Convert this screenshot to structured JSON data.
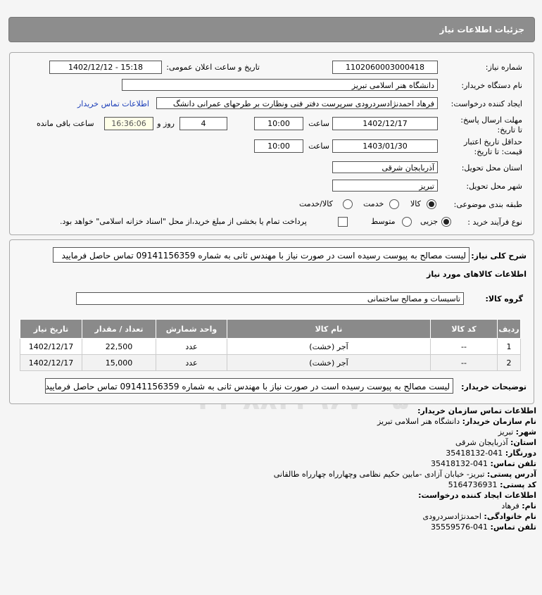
{
  "header": {
    "title": "جزئیات اطلاعات نیاز"
  },
  "form": {
    "need_number_label": "شماره نیاز:",
    "need_number": "1102060003000418",
    "announce_label": "تاریخ و ساعت اعلان عمومی:",
    "announce_value": "1402/12/12 - 15:18",
    "buyer_org_label": "نام دستگاه خریدار:",
    "buyer_org": "دانشگاه هنر اسلامی تبریز",
    "creator_label": "ایجاد کننده درخواست:",
    "creator": "فرهاد احمدنژادسردرودی سرپرست دفتر فنی ونظارت بر طرحهای عمرانی دانشگ",
    "contact_link": "اطلاعات تماس خریدار",
    "deadline_label": "مهلت ارسال پاسخ: تا تاریخ:",
    "deadline_date": "1402/12/17",
    "time_label": "ساعت",
    "deadline_time": "10:00",
    "days_value": "4",
    "days_label": "روز و",
    "remaining_time": "16:36:06",
    "remaining_label": "ساعت باقی مانده",
    "validity_label": "حداقل تاریخ اعتبار قیمت: تا تاریخ:",
    "validity_date": "1403/01/30",
    "validity_time_label": "ساعت",
    "validity_time": "10:00",
    "province_label": "استان محل تحویل:",
    "province": "آذربایجان شرقی",
    "city_label": "شهر محل تحویل:",
    "city": "تبریز",
    "category_label": "طبقه بندی موضوعی:",
    "category_options": [
      "کالا",
      "خدمت",
      "کالا/خدمت"
    ],
    "process_label": "نوع فرآیند خرید :",
    "process_options": [
      "جزیی",
      "متوسط"
    ],
    "payment_note": "پرداخت تمام یا بخشی از مبلغ خرید،از محل \"اسناد خزانه اسلامی\" خواهد بود."
  },
  "summary": {
    "label": "شرح کلی نیاز:",
    "text": "لیست مصالح به پیوست رسیده است در صورت نیاز با مهندس ثانی به شماره 09141156359 تماس حاصل فرمایید",
    "items_title": "اطلاعات کالاهای مورد نیاز",
    "group_label": "گروه کالا:",
    "group_value": "تاسیسات و مصالح ساختمانی"
  },
  "table": {
    "headers": [
      "ردیف",
      "کد کالا",
      "نام کالا",
      "واحد شمارش",
      "تعداد / مقدار",
      "تاریخ نیاز"
    ],
    "rows": [
      [
        "1",
        "--",
        "آجر (خشت)",
        "عدد",
        "22,500",
        "1402/12/17"
      ],
      [
        "2",
        "--",
        "آجر (خشت)",
        "عدد",
        "15,000",
        "1402/12/17"
      ]
    ]
  },
  "buyer_notes": {
    "label": "توضیحات خریدار:",
    "text": "لیست مصالح به پیوست رسیده است در صورت نیاز با مهندس ثانی به شماره 09141156359 تماس حاصل فرمایید"
  },
  "contact": {
    "section_title": "اطلاعات تماس سازمان خریدار:",
    "org_label": "نام سازمان خریدار:",
    "org": "دانشگاه هنر اسلامی تبریز",
    "city_label": "شهر:",
    "city": "تبریز",
    "province_label": "استان:",
    "province": "آذربایجان شرقی",
    "fax_label": "دورنگار:",
    "fax": "041-35418132",
    "phone_label": "تلفن تماس:",
    "phone": "041-35418132",
    "address_label": "آدرس پستی:",
    "address": "تبریز- خیابان آزادی -مابین حکیم نظامی وچهارراه چهارراه طالقانی",
    "postal_label": "کد پستی:",
    "postal": "5164736931",
    "creator_section": "اطلاعات ایجاد کننده درخواست:",
    "name_label": "نام:",
    "name": "فرهاد",
    "family_label": "نام خانوادگی:",
    "family": "احمدنژادسردرودی",
    "creator_phone_label": "تلفن تماس:",
    "creator_phone": "041-35559576"
  },
  "watermark": {
    "brand": "ParsNamadData",
    "sub": "مرکز فراهم آوری و ارائه اطلاعات پارس نماد داده ها",
    "sub2": "پایگاه اطلاع رسانی مناقصه و مزایده",
    "phone": "۰۲۱-۸۸۳۴۹۶۷۰-۵",
    "digits": "010101"
  },
  "colors": {
    "link": "#1a3db8",
    "header_bg": "#8d8d8d",
    "remaining_bg": "#ffffe8"
  }
}
